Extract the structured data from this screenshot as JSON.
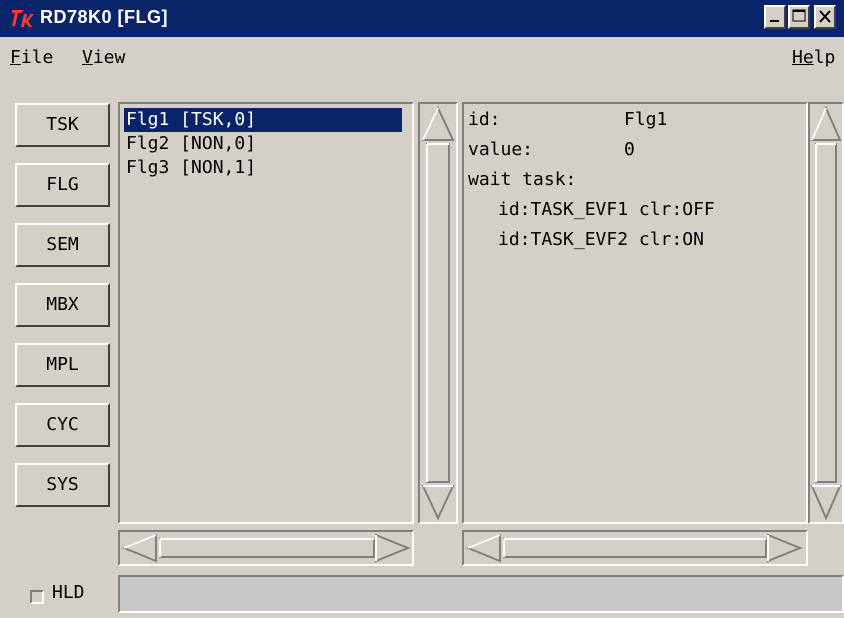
{
  "window": {
    "title": "RD78K0 [FLG]",
    "titlebar_color": "#0a246a",
    "controls": [
      "minimize-icon",
      "maximize-icon",
      "close-icon"
    ]
  },
  "menu": {
    "file": {
      "accel": "F",
      "rest": "ile"
    },
    "view": {
      "accel": "V",
      "rest": "iew"
    },
    "help": {
      "accel": "He",
      "rest": "lp"
    }
  },
  "nav_buttons": [
    "TSK",
    "FLG",
    "SEM",
    "MBX",
    "MPL",
    "CYC",
    "SYS"
  ],
  "flag_list": {
    "items": [
      "Flg1 [TSK,0]",
      "Flg2 [NON,0]",
      "Flg3 [NON,1]"
    ],
    "selected_index": 0
  },
  "detail": {
    "id_label": "id:",
    "id_value": "Flg1",
    "value_label": "value:",
    "value_value": "0",
    "wait_label": "wait task:",
    "wait_tasks": [
      "id:TASK_EVF1 clr:OFF",
      "id:TASK_EVF2 clr:ON"
    ]
  },
  "bottom": {
    "hold_label": "HLD",
    "hold_checked": false,
    "status_text": ""
  },
  "colors": {
    "face": "#d4d0c8",
    "selection": "#0a246a",
    "status_bar": "#c8c8c8"
  }
}
